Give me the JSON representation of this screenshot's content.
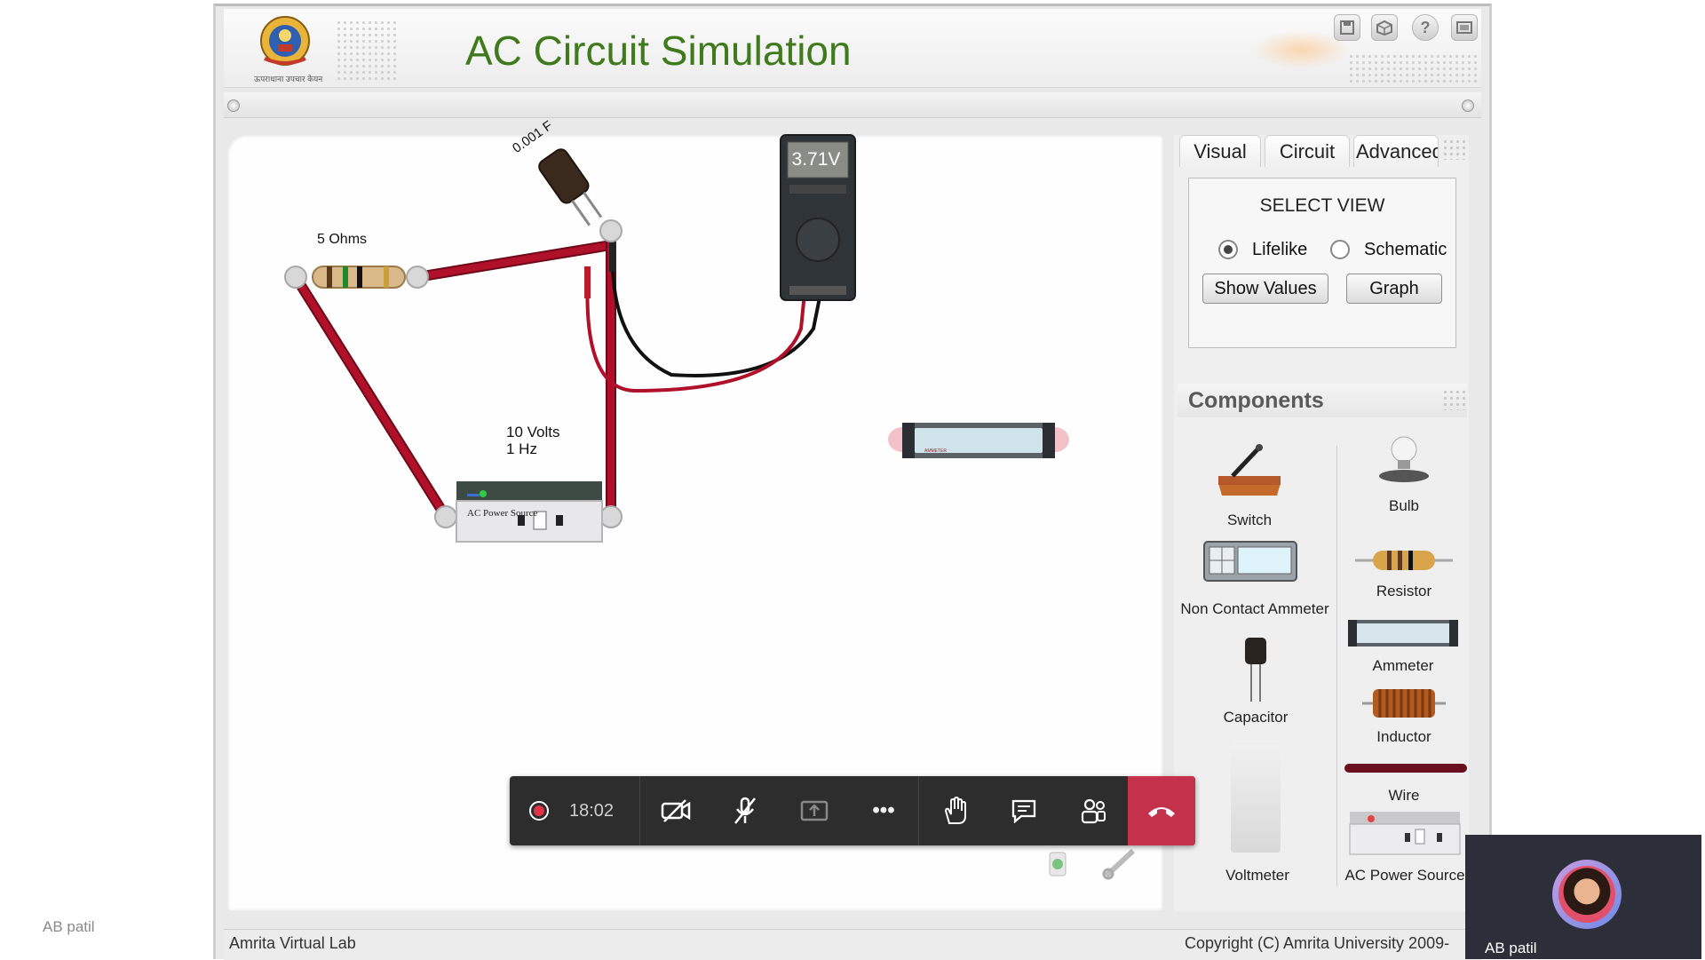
{
  "app": {
    "title": "AC Circuit Simulation",
    "logo_caption": "ऊपराधाना  उपचार  केयन",
    "header_icons": [
      "save-icon",
      "load-icon",
      "help-icon",
      "fullscreen-icon"
    ]
  },
  "tabs": [
    {
      "label": "Visual"
    },
    {
      "label": "Circuit"
    },
    {
      "label": "Advanced"
    }
  ],
  "select_view": {
    "heading": "SELECT VIEW",
    "options": [
      {
        "label": "Lifelike",
        "selected": true
      },
      {
        "label": "Schematic",
        "selected": false
      }
    ],
    "show_values_label": "Show Values",
    "graph_label": "Graph"
  },
  "components": {
    "heading": "Components",
    "items": [
      {
        "label": "Switch",
        "icon": "switch-icon"
      },
      {
        "label": "Bulb",
        "icon": "bulb-icon"
      },
      {
        "label": "Non Contact Ammeter",
        "icon": "non-contact-ammeter-icon"
      },
      {
        "label": "Resistor",
        "icon": "resistor-icon"
      },
      {
        "label": "Ammeter",
        "icon": "ammeter-icon"
      },
      {
        "label": "Capacitor",
        "icon": "capacitor-icon"
      },
      {
        "label": "Inductor",
        "icon": "inductor-icon"
      },
      {
        "label": "Wire",
        "icon": "wire-icon"
      },
      {
        "label": "Voltmeter",
        "icon": "voltmeter-icon"
      },
      {
        "label": "AC Power Source",
        "icon": "ac-power-source-icon"
      }
    ]
  },
  "circuit": {
    "resistor_label": "5 Ohms",
    "capacitor_label": "0.001 F",
    "source_label_line1": "10 Volts",
    "source_label_line2": "1 Hz",
    "source_face_text": "AC Power Source",
    "multimeter_reading": "3.71V",
    "ammeter_face_text": "AMMETER"
  },
  "footer": {
    "left": "Amrita Virtual Lab",
    "right": "Copyright (C) Amrita University 2009-"
  },
  "call": {
    "timer": "18:02",
    "recording": true,
    "buttons": [
      "camera-off-icon",
      "mic-off-icon",
      "share-screen-icon",
      "more-icon",
      "raise-hand-icon",
      "chat-icon",
      "participants-icon",
      "hang-up-icon"
    ],
    "hangup_color": "#c4314b",
    "participant_name": "AB patil",
    "watermark_name": "AB patil"
  },
  "colors": {
    "title_green": "#3f7a1c",
    "wire_red": "#b0102a",
    "call_bar": "#2d2d2d"
  }
}
